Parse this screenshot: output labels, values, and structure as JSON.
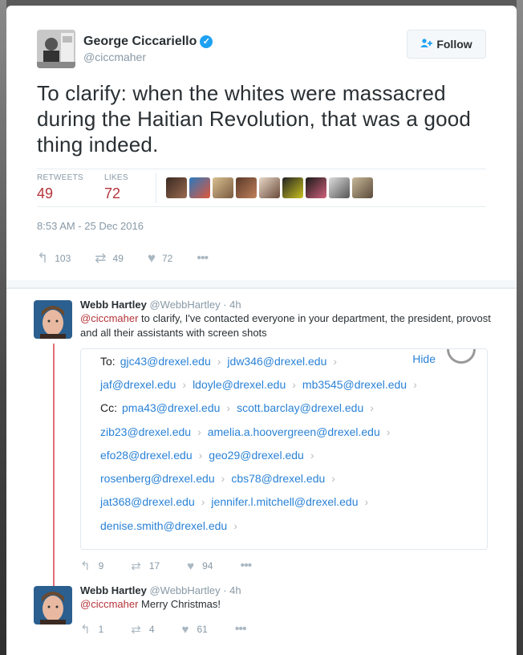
{
  "tweet": {
    "author_name": "George Ciccariello",
    "author_handle": "@ciccmaher",
    "follow_label": "Follow",
    "text": "To clarify: when the whites were massacred during the Haitian Revolution, that was a good thing indeed.",
    "retweets_label": "RETWEETS",
    "retweets_count": "49",
    "likes_label": "LIKES",
    "likes_count": "72",
    "timestamp": "8:53 AM - 25 Dec 2016",
    "actions": {
      "reply": "103",
      "retweet": "49",
      "like": "72"
    }
  },
  "replies": [
    {
      "name": "Webb Hartley",
      "handle": "@WebbHartley",
      "time": "· 4h",
      "mention": "@ciccmaher",
      "text": " to clarify, I've contacted everyone in your department, the president, provost and all their assistants with screen shots",
      "media": {
        "to_label": "To:",
        "cc_label": "Cc:",
        "hide_label": "Hide",
        "rows": [
          [
            "gjc43@drexel.edu",
            "jdw346@drexel.edu"
          ],
          [
            "jaf@drexel.edu",
            "ldoyle@drexel.edu",
            "mb3545@drexel.edu"
          ],
          [
            "pma43@drexel.edu",
            "scott.barclay@drexel.edu"
          ],
          [
            "zib23@drexel.edu",
            "amelia.a.hoovergreen@drexel.edu"
          ],
          [
            "efo28@drexel.edu",
            "geo29@drexel.edu"
          ],
          [
            "rosenberg@drexel.edu",
            "cbs78@drexel.edu"
          ],
          [
            "jat368@drexel.edu",
            "jennifer.l.mitchell@drexel.edu"
          ],
          [
            "denise.smith@drexel.edu"
          ]
        ]
      },
      "actions": {
        "reply": "9",
        "retweet": "17",
        "like": "94"
      }
    },
    {
      "name": "Webb Hartley",
      "handle": "@WebbHartley",
      "time": "· 4h",
      "mention": "@ciccmaher",
      "text": " Merry Christmas!",
      "actions": {
        "reply": "1",
        "retweet": "4",
        "like": "61"
      }
    }
  ],
  "icons": {
    "reply": "↰",
    "retweet": "⇄",
    "like": "♥",
    "more": "•••",
    "follow": "👤+",
    "verified": "✓"
  },
  "colors": {
    "accent": "#1da1f2",
    "count_red": "#b5343a",
    "thread_line": "#e26f78"
  }
}
